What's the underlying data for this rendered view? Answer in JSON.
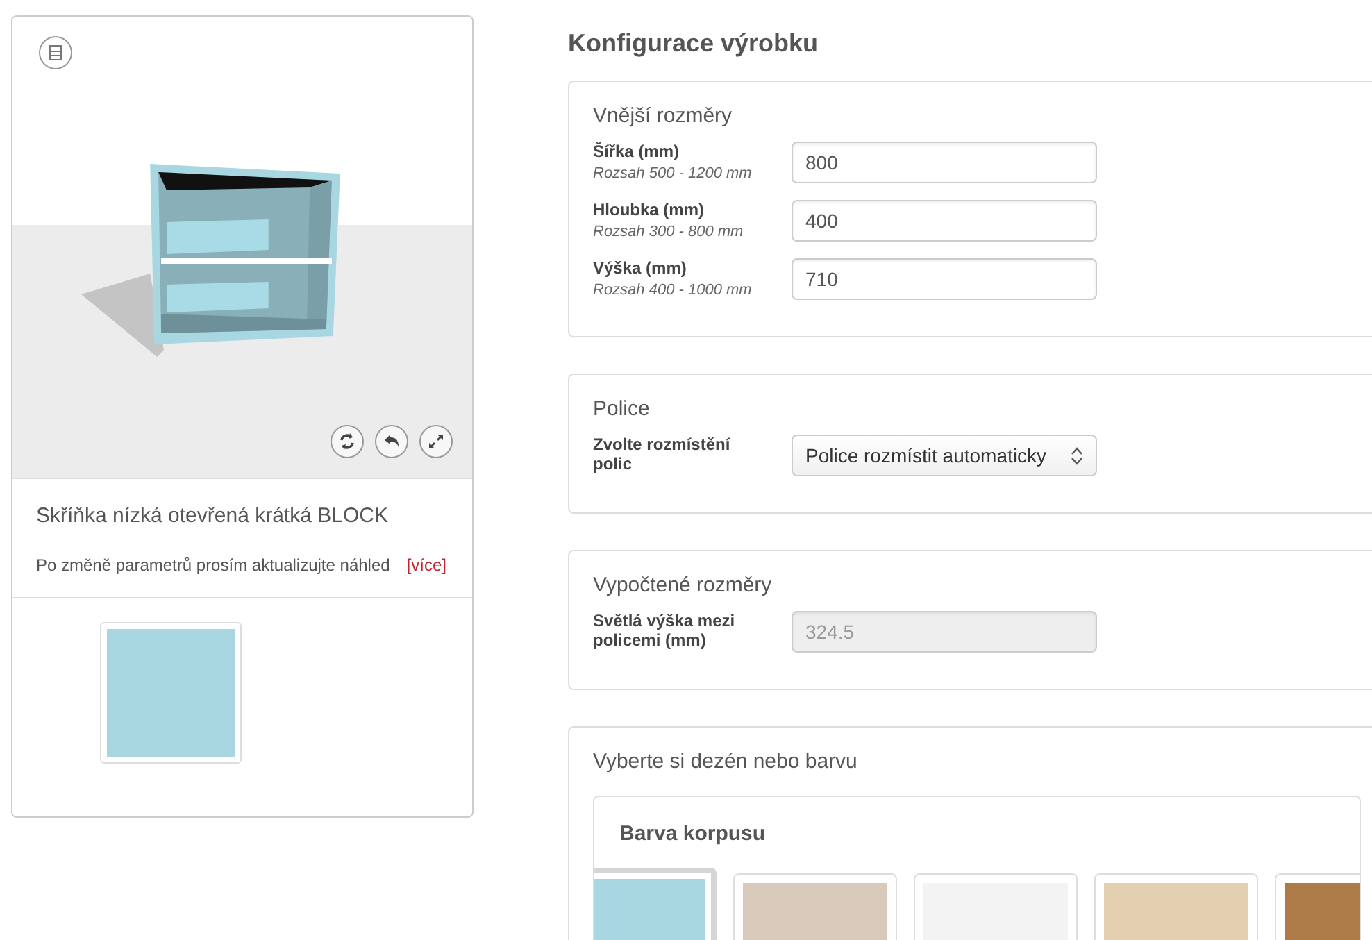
{
  "product": {
    "name": "Skříňka nízká otevřená krátká BLOCK",
    "note": "Po změně parametrů prosím aktualizujte náhled",
    "more_link": "[více]",
    "thumbnail": {
      "color": "#a8d7e2"
    }
  },
  "configuration": {
    "title": "Konfigurace výrobku",
    "sections": [
      {
        "kind": "fields",
        "title": "Vnější rozměry",
        "fields": [
          {
            "label": "Šířka (mm)",
            "hint": "Rozsah 500 - 1200 mm",
            "value": "800",
            "disabled": false
          },
          {
            "label": "Hloubka (mm)",
            "hint": "Rozsah 300 - 800 mm",
            "value": "400",
            "disabled": false
          },
          {
            "label": "Výška (mm)",
            "hint": "Rozsah 400 - 1000 mm",
            "value": "710",
            "disabled": false
          }
        ]
      },
      {
        "kind": "select",
        "title": "Police",
        "fields": [
          {
            "label": "Zvolte rozmístění polic",
            "value": "Police rozmístit automaticky"
          }
        ]
      },
      {
        "kind": "fields",
        "title": "Vypočtené rozměry",
        "fields": [
          {
            "label": "Světlá výška mezi policemi (mm)",
            "value": "324.5",
            "disabled": true
          }
        ]
      },
      {
        "kind": "swatches",
        "title": "Vyberte si dezén nebo barvu",
        "group": "Barva korpusu",
        "swatches": [
          {
            "color": "#a8d7e2",
            "selected": true
          },
          {
            "color": "#d8c9bb",
            "selected": false
          },
          {
            "color": "#f3f3f3",
            "selected": false
          },
          {
            "color": "#e3d0b0",
            "selected": false
          },
          {
            "color": "#ad7b48",
            "selected": false
          }
        ]
      }
    ]
  }
}
